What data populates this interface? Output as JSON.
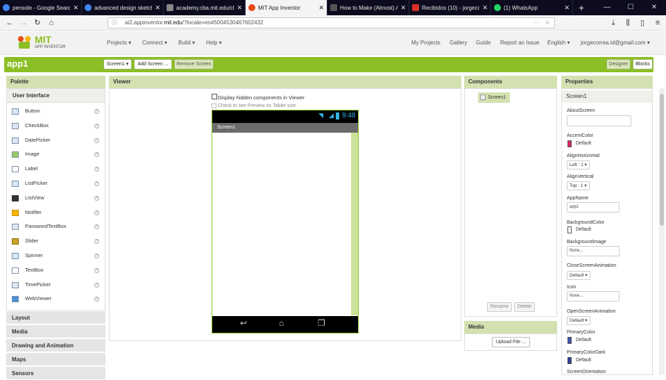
{
  "browser": {
    "tabs": [
      {
        "label": "pensole - Google Search",
        "color": "#4285f4"
      },
      {
        "label": "advanced design sketch",
        "color": "#4285f4"
      },
      {
        "label": "academy.cba.mit.edu/classe",
        "color": "#888888"
      },
      {
        "label": "MIT App Inventor",
        "color": "#e64a19"
      },
      {
        "label": "How to Make (Almost) A",
        "color": "#555555"
      },
      {
        "label": "Recibidos (10) - jorgeco",
        "color": "#d93025"
      },
      {
        "label": "(1) WhatsApp",
        "color": "#25d366"
      }
    ],
    "url_prefix": "ai2.appinventor.",
    "url_domain": "mit.edu",
    "url_rest": "/?locale=en#5004530467602432"
  },
  "header": {
    "logo_top": "MIT",
    "logo_bottom": "APP INVENTOR",
    "menu": [
      "Projects ▾",
      "Connect ▾",
      "Build ▾",
      "Help ▾"
    ],
    "right_menu": [
      "My Projects",
      "Gallery",
      "Guide",
      "Report an Issue",
      "English ▾",
      "jorgecorrea.id@gmail.com ▾"
    ]
  },
  "toolbar": {
    "app_name": "app1",
    "screen_select": "Screen1 ▾",
    "add_screen": "Add Screen ...",
    "remove_screen": "Remove Screen",
    "designer": "Designer",
    "blocks": "Blocks"
  },
  "palette": {
    "title": "Palette",
    "section": "User Interface",
    "items": [
      "Button",
      "CheckBox",
      "DatePicker",
      "Image",
      "Label",
      "ListPicker",
      "ListView",
      "Notifier",
      "PasswordTextBox",
      "Slider",
      "Spinner",
      "TextBox",
      "TimePicker",
      "WebViewer"
    ],
    "help": "?",
    "sections": [
      "Layout",
      "Media",
      "Drawing and Animation",
      "Maps",
      "Sensors"
    ]
  },
  "viewer": {
    "title": "Viewer",
    "hidden_label": "Display hidden components in Viewer",
    "tablet_label": "Check to see Preview on Tablet size.",
    "time": "9:48",
    "screen_title": "Screen1"
  },
  "components": {
    "title": "Components",
    "tree_item": "Screen1",
    "rename": "Rename",
    "delete": "Delete"
  },
  "media": {
    "title": "Media",
    "upload": "Upload File ..."
  },
  "properties": {
    "title": "Properties",
    "component": "Screen1",
    "about_label": "AboutScreen",
    "accent_label": "AccentColor",
    "accent_value": "Default",
    "accent_color": "#e0245e",
    "align_h_label": "AlignHorizontal",
    "align_h_value": "Left : 1 ▾",
    "align_v_label": "AlignVertical",
    "align_v_value": "Top : 1 ▾",
    "appname_label": "AppName",
    "appname_value": "app1",
    "bgcolor_label": "BackgroundColor",
    "bgcolor_value": "Default",
    "bgimage_label": "BackgroundImage",
    "bgimage_value": "None...",
    "close_anim_label": "CloseScreenAnimation",
    "close_anim_value": "Default ▾",
    "icon_label": "Icon",
    "icon_value": "None...",
    "open_anim_label": "OpenScreenAnimation",
    "open_anim_value": "Default ▾",
    "primary_label": "PrimaryColor",
    "primary_value": "Default",
    "primary_color": "#3f51b5",
    "primary_dark_label": "PrimaryColorDark",
    "primary_dark_value": "Default",
    "primary_dark_color": "#303f9f",
    "orientation_label": "ScreenOrientation"
  },
  "colors": {
    "accent_green": "#8cbf26"
  }
}
